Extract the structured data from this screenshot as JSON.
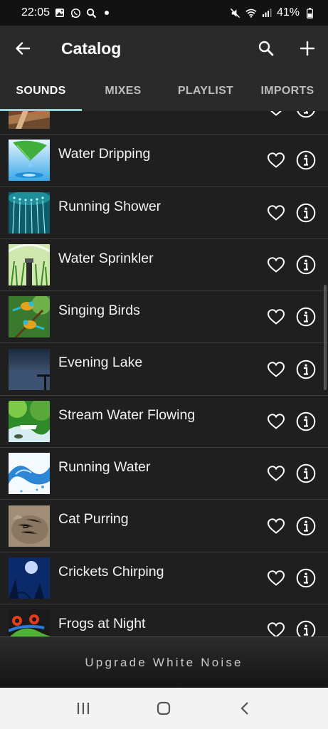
{
  "status_bar": {
    "time": "22:05",
    "battery": "41%",
    "icons": [
      "gallery-icon",
      "whatsapp-icon",
      "search-icon",
      "dot-icon",
      "mute-icon",
      "wifi-icon",
      "signal-icon",
      "battery-icon"
    ]
  },
  "app_bar": {
    "title": "Catalog",
    "back_icon": "arrow-left-icon",
    "actions": [
      "search-icon",
      "plus-icon"
    ]
  },
  "tabs": [
    {
      "label": "SOUNDS",
      "active": true
    },
    {
      "label": "MIXES",
      "active": false
    },
    {
      "label": "PLAYLIST",
      "active": false
    },
    {
      "label": "IMPORTS",
      "active": false
    }
  ],
  "sounds": [
    {
      "label": "",
      "thumb": "wood",
      "favorited": false
    },
    {
      "label": "Water Dripping",
      "thumb": "drip",
      "favorited": false
    },
    {
      "label": "Running Shower",
      "thumb": "shower",
      "favorited": false
    },
    {
      "label": "Water Sprinkler",
      "thumb": "sprinkler",
      "favorited": false
    },
    {
      "label": "Singing Birds",
      "thumb": "birds",
      "favorited": false
    },
    {
      "label": "Evening Lake",
      "thumb": "lake",
      "favorited": false
    },
    {
      "label": "Stream Water Flowing",
      "thumb": "stream",
      "favorited": false
    },
    {
      "label": "Running Water",
      "thumb": "water",
      "favorited": false
    },
    {
      "label": "Cat Purring",
      "thumb": "cat",
      "favorited": false
    },
    {
      "label": "Crickets Chirping",
      "thumb": "crickets",
      "favorited": false
    },
    {
      "label": "Frogs at Night",
      "thumb": "frog",
      "favorited": false
    }
  ],
  "upgrade": {
    "label": "Upgrade White Noise"
  },
  "nav_bar": {
    "buttons": [
      "recents-icon",
      "home-icon",
      "back-icon"
    ]
  },
  "colors": {
    "accent": "#8fd3d3",
    "background": "#1f1f1f",
    "app_bar": "#2a2a2a"
  }
}
